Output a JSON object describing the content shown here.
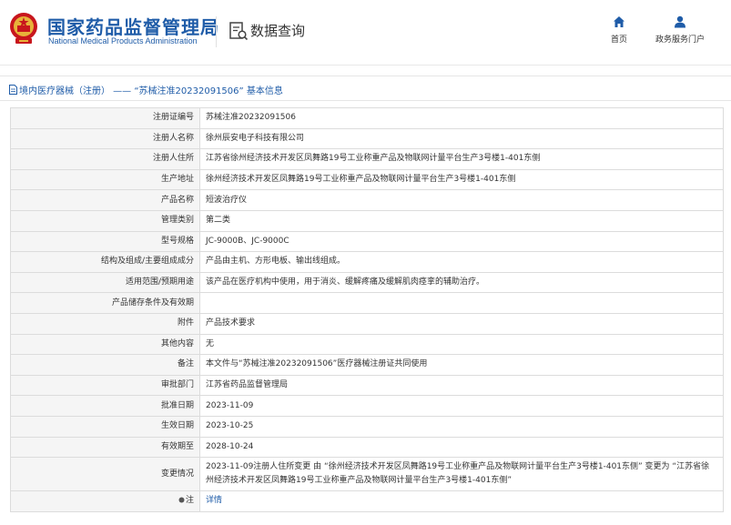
{
  "header": {
    "brand_cn": "国家药品监督管理局",
    "brand_en": "National Medical Products Administration",
    "query_title": "数据查询",
    "nav_home": "首页",
    "nav_portal": "政务服务门户",
    "accent_color": "#1f5ca8",
    "emblem_color": "#c8161d"
  },
  "breadcrumb": {
    "text": "境内医疗器械（注册） —— “苏械注准20232091506” 基本信息"
  },
  "details": {
    "rows": [
      {
        "label": "注册证编号",
        "value": "苏械注准20232091506"
      },
      {
        "label": "注册人名称",
        "value": "徐州辰安电子科技有限公司"
      },
      {
        "label": "注册人住所",
        "value": "江苏省徐州经济技术开发区凤舞路19号工业称重产品及物联网计量平台生产3号楼1-401东侧"
      },
      {
        "label": "生产地址",
        "value": "徐州经济技术开发区凤舞路19号工业称重产品及物联网计量平台生产3号楼1-401东侧"
      },
      {
        "label": "产品名称",
        "value": "短波治疗仪"
      },
      {
        "label": "管理类别",
        "value": "第二类"
      },
      {
        "label": "型号规格",
        "value": "JC-9000B、JC-9000C"
      },
      {
        "label": "结构及组成/主要组成成分",
        "value": "产品由主机、方形电板、输出线组成。"
      },
      {
        "label": "适用范围/预期用途",
        "value": "该产品在医疗机构中使用，用于消炎、缓解疼痛及缓解肌肉痉挛的辅助治疗。"
      },
      {
        "label": "产品储存条件及有效期",
        "value": ""
      },
      {
        "label": "附件",
        "value": "产品技术要求"
      },
      {
        "label": "其他内容",
        "value": "无"
      },
      {
        "label": "备注",
        "value": "本文件与“苏械注准20232091506”医疗器械注册证共同使用"
      },
      {
        "label": "审批部门",
        "value": "江苏省药品监督管理局"
      },
      {
        "label": "批准日期",
        "value": "2023-11-09"
      },
      {
        "label": "生效日期",
        "value": "2023-10-25"
      },
      {
        "label": "有效期至",
        "value": "2028-10-24"
      }
    ],
    "change_label": "变更情况",
    "change_value": "2023-11-09注册人住所变更 由 “徐州经济技术开发区凤舞路19号工业称重产品及物联网计量平台生产3号楼1-401东侧” 变更为 “江苏省徐州经济技术开发区凤舞路19号工业称重产品及物联网计量平台生产3号楼1-401东侧”",
    "note_label": "注",
    "note_link": "详情"
  }
}
